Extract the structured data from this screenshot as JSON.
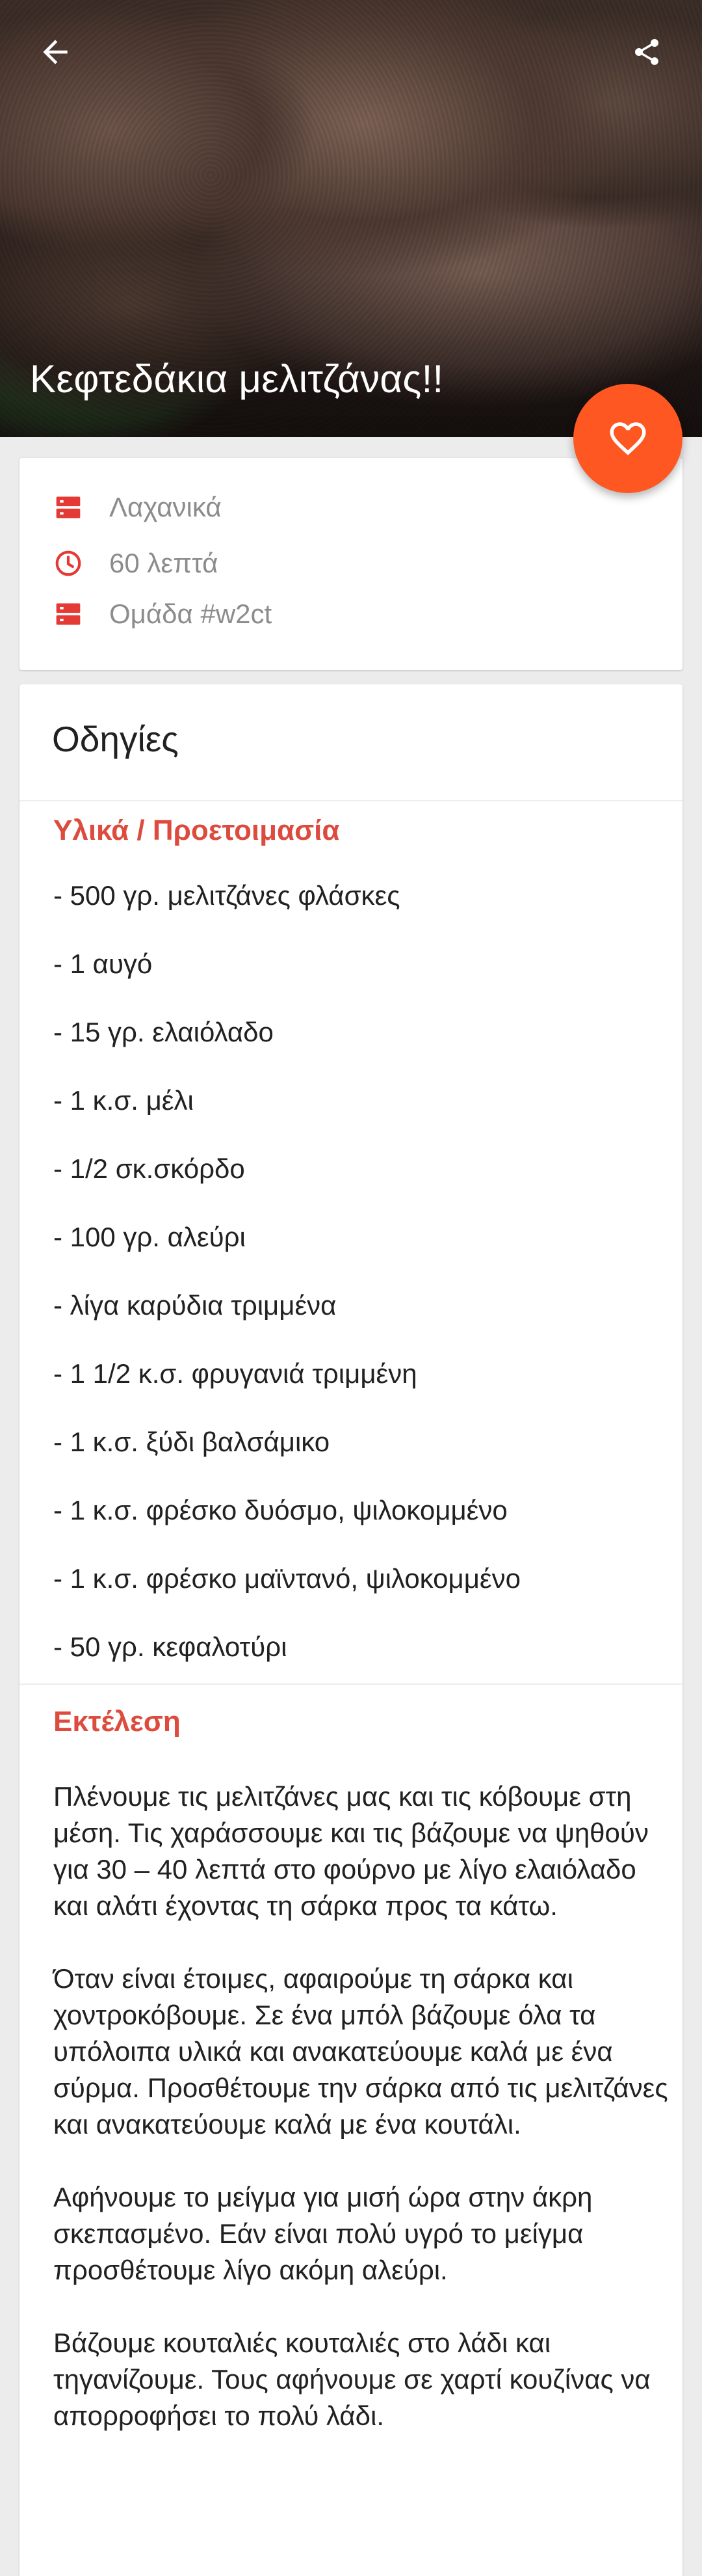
{
  "header": {
    "back_icon": "arrow-left-icon",
    "share_icon": "share-icon"
  },
  "recipe": {
    "title": "Κεφτεδάκια μελιτζάνας!!",
    "favorite_icon": "heart-outline-icon"
  },
  "meta": {
    "category": "Λαχανικά",
    "duration": "60 λεπτά",
    "group": "Ομάδα #w2ct"
  },
  "instructions": {
    "title": "Οδηγίες",
    "ingredients_heading": "Υλικά / Προετοιμασία",
    "ingredients": [
      "- 500 γρ. μελιτζάνες φλάσκες",
      "- 1 αυγό",
      "- 15 γρ. ελαιόλαδο",
      "- 1 κ.σ. μέλι",
      "- 1/2 σκ.σκόρδο",
      "- 100 γρ. αλεύρι",
      "- λίγα καρύδια τριμμένα",
      "- 1 1/2 κ.σ. φρυγανιά τριμμένη",
      "- 1 κ.σ. ξύδι βαλσάμικο",
      "- 1 κ.σ. φρέσκο δυόσμο, ψιλοκομμένο",
      "- 1 κ.σ. φρέσκο μαϊντανό, ψιλοκομμένο",
      "- 50 γρ. κεφαλοτύρι"
    ],
    "execution_heading": "Εκτέλεση",
    "paragraphs": [
      "Πλένουμε τις μελιτζάνες μας και τις κόβουμε στη μέση. Τις χαράσσουμε και τις βάζουμε να ψηθούν για 30 – 40 λεπτά στο φούρνο με λίγο ελαιόλαδο και αλάτι έχοντας τη σάρκα προς τα κάτω.",
      "Όταν είναι έτοιμες, αφαιρούμε τη σάρκα και χοντροκόβουμε. Σε ένα μπόλ βάζουμε όλα τα υπόλοιπα υλικά και ανακατεύουμε καλά με ένα σύρμα. Προσθέτουμε την σάρκα από τις μελιτζάνες και ανακατεύουμε καλά με ένα κουτάλι.",
      "Αφήνουμε το μείγμα για μισή ώρα στην άκρη σκεπασμένο. Εάν είναι πολύ υγρό το μείγμα προσθέτουμε λίγο ακόμη αλεύρι.",
      "Βάζουμε κουταλιές κουταλιές στο λάδι και τηγανίζουμε. Τους αφήνουμε σε χαρτί κουζίνας να απορροφήσει το πολύ λάδι."
    ]
  },
  "colors": {
    "accent": "#fe5722",
    "section_heading": "#dd4b3e",
    "meta_icon": "#e53935"
  }
}
